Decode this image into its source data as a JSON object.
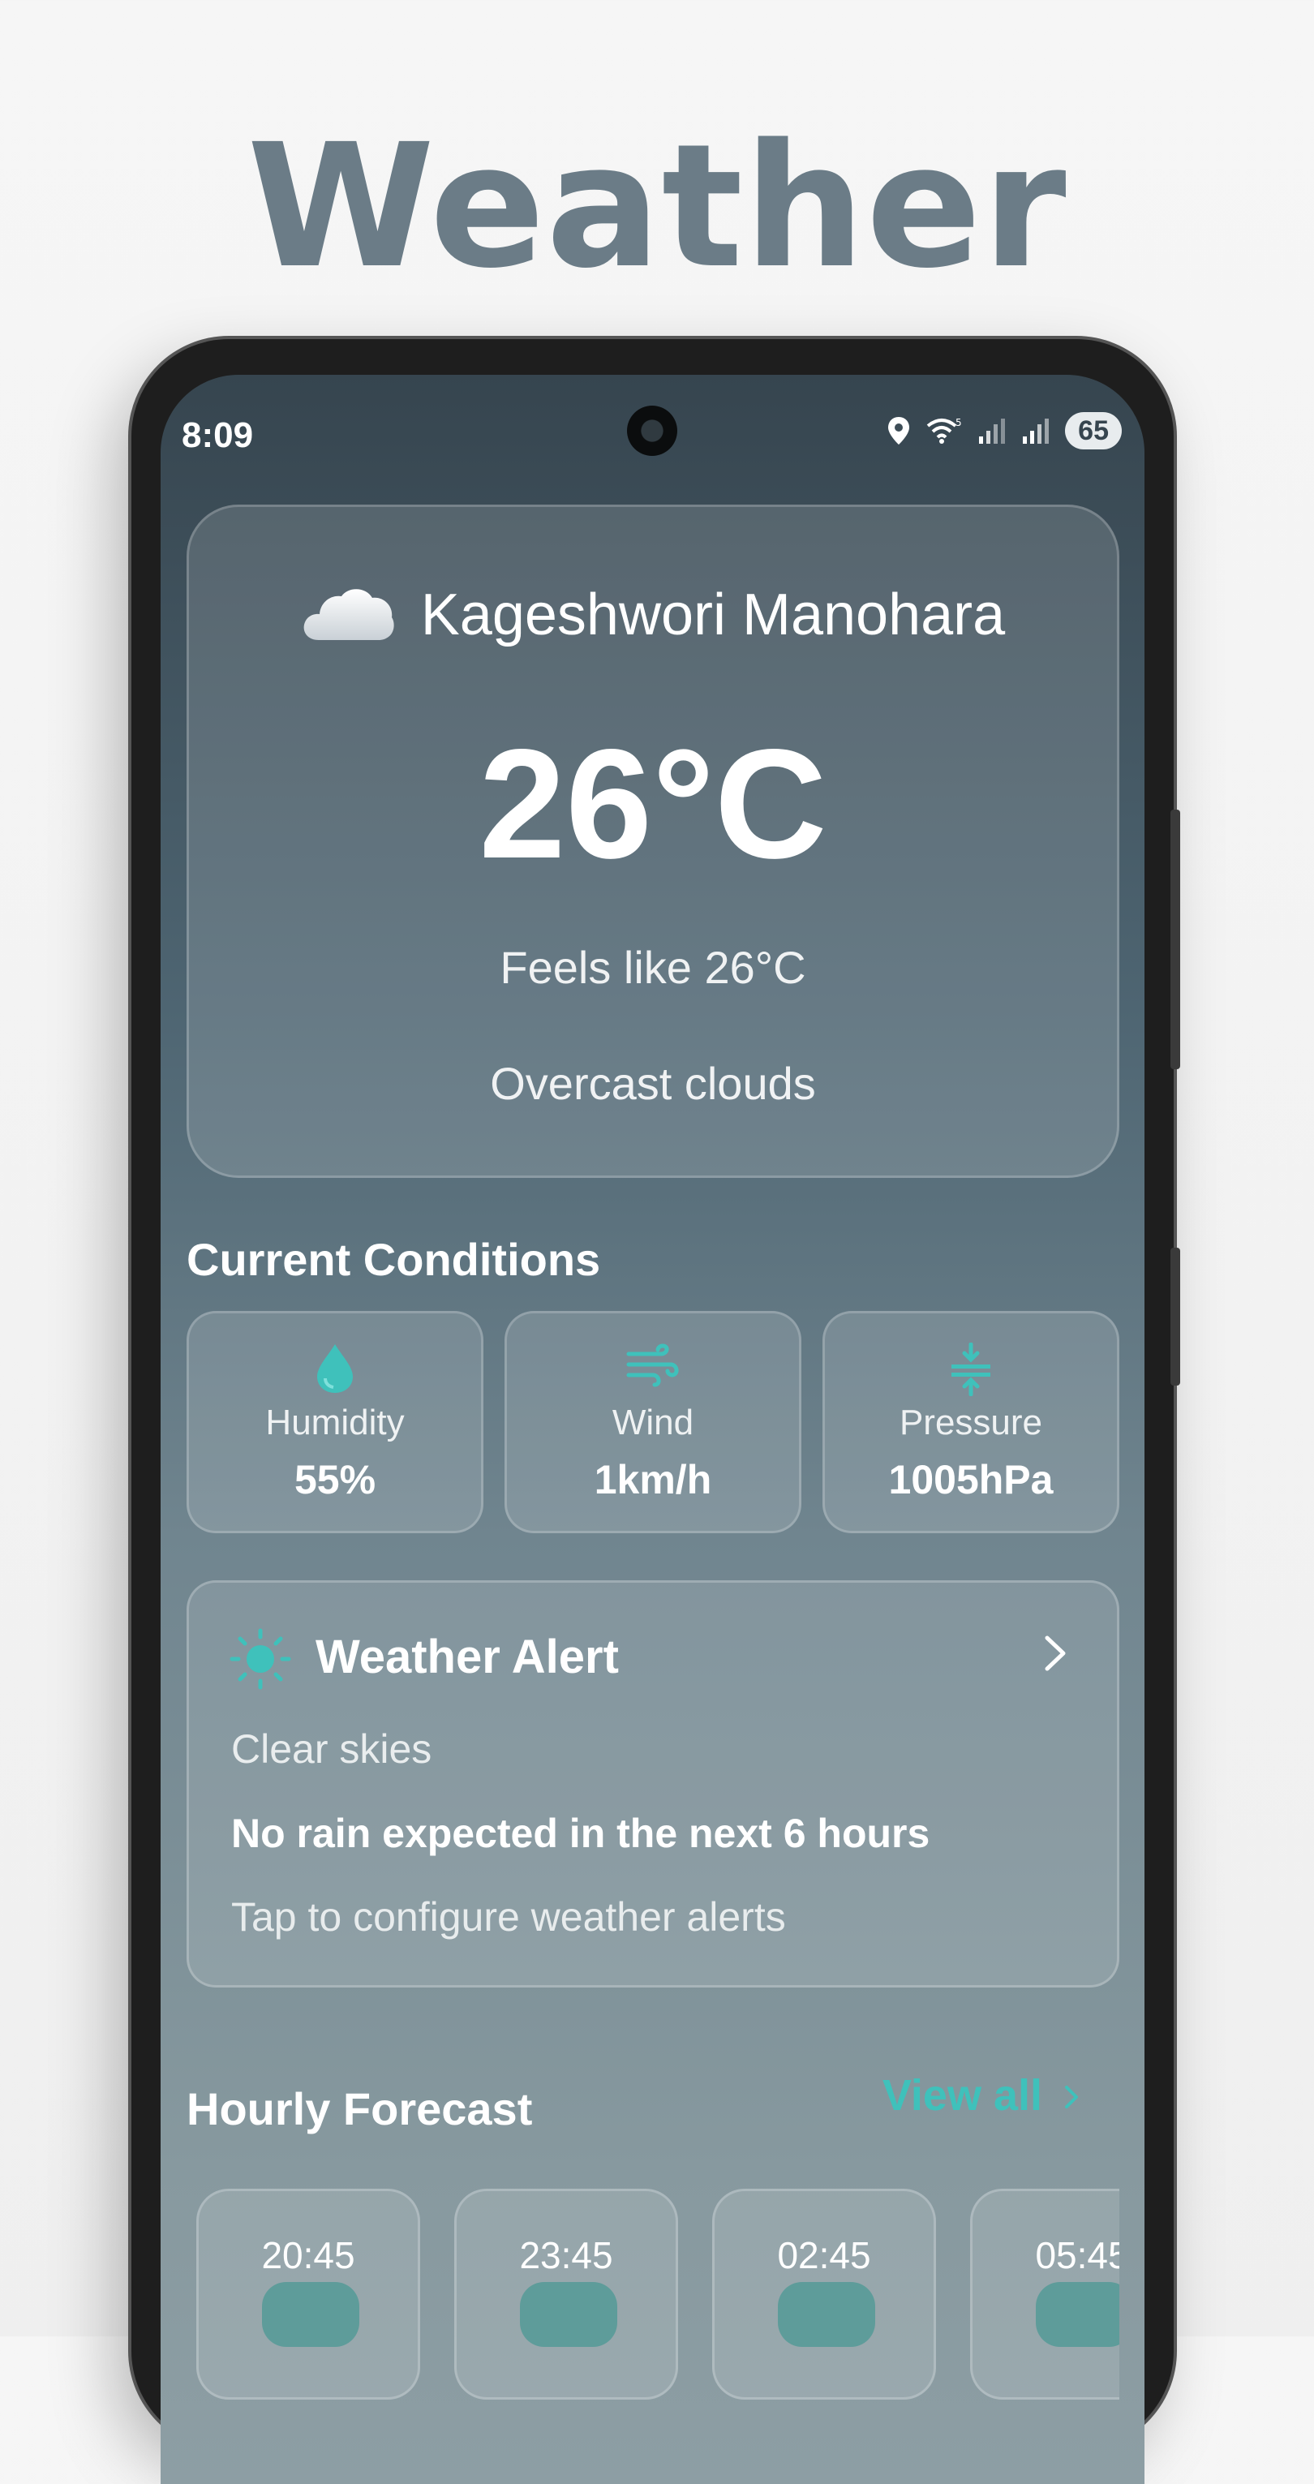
{
  "promo": {
    "title": "Weather"
  },
  "status_bar": {
    "time": "8:09",
    "battery": "65",
    "icons": [
      "location-icon",
      "wifi-icon",
      "signal-icon",
      "signal-icon"
    ]
  },
  "current": {
    "location": "Kageshwori Manohara",
    "condition_icon": "cloud-icon",
    "temperature": "26°C",
    "feels_like": "Feels like 26°C",
    "description": "Overcast clouds"
  },
  "conditions": {
    "title": "Current Conditions",
    "items": [
      {
        "label": "Humidity",
        "value": "55%",
        "icon": "humidity-drop-icon"
      },
      {
        "label": "Wind",
        "value": "1km/h",
        "icon": "wind-icon"
      },
      {
        "label": "Pressure",
        "value": "1005hPa",
        "icon": "pressure-icon"
      }
    ]
  },
  "alert": {
    "title": "Weather Alert",
    "subtitle": "Clear skies",
    "message": "No rain expected in the next 6 hours",
    "hint": "Tap to configure weather alerts",
    "icon": "sun-icon"
  },
  "hourly": {
    "title": "Hourly Forecast",
    "view_all": "View all",
    "items": [
      {
        "time": "20:45"
      },
      {
        "time": "23:45"
      },
      {
        "time": "02:45"
      },
      {
        "time": "05:45"
      }
    ]
  },
  "colors": {
    "accent": "#3fc1bb",
    "title_gray": "#6b7c87",
    "bg_top": "#36454f",
    "bg_bottom": "#8d9ea4"
  }
}
